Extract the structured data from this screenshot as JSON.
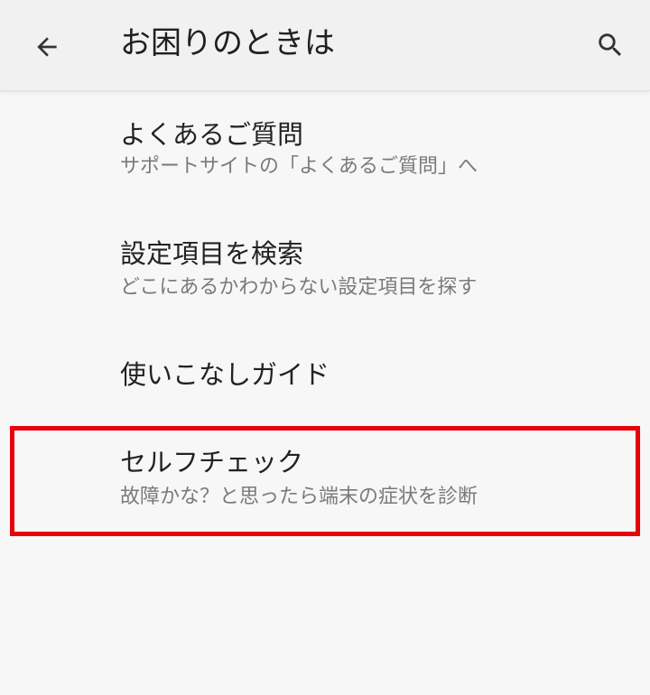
{
  "header": {
    "title": "お困りのときは",
    "back_icon": "arrow-back-icon",
    "search_icon": "search-icon"
  },
  "items": [
    {
      "title": "よくあるご質問",
      "subtitle": "サポートサイトの「よくあるご質問」へ"
    },
    {
      "title": "設定項目を検索",
      "subtitle": "どこにあるかわからない設定項目を探す"
    },
    {
      "title": "使いこなしガイド"
    },
    {
      "title": "セルフチェック",
      "subtitle": "故障かな？と思ったら端末の症状を診断"
    }
  ],
  "colors": {
    "highlight": "#e8000b",
    "background": "#f7f7f7",
    "app_bar": "#f1f1f1"
  }
}
